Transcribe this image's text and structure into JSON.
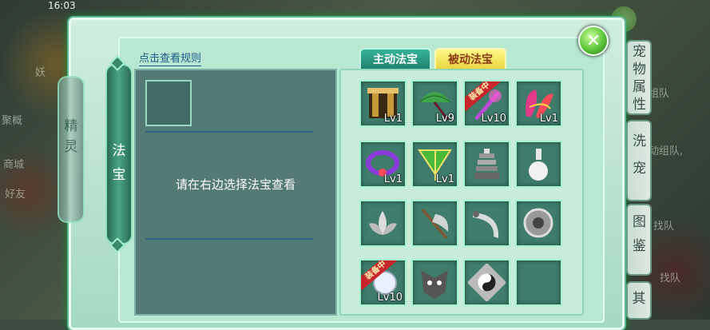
{
  "status_time": "16:03",
  "background_hints": [
    "妖",
    "聚概",
    "商城",
    "好友",
    "宠物属性",
    "组队",
    "动组队,",
    "找队",
    "找队"
  ],
  "rules_link": "点击查看规则",
  "hint_text": "请在右边选择法宝查看",
  "tabs": {
    "active": "主动法宝",
    "inactive": "被动法宝"
  },
  "left_tabs": [
    {
      "label": "精灵",
      "active": false
    },
    {
      "label": "法宝",
      "active": true
    }
  ],
  "right_tabs": [
    "宠物属性",
    "洗宠",
    "图鉴",
    "其"
  ],
  "close_label": "✕",
  "equipped_label": "装备中",
  "slots": [
    {
      "icon": "gate-icon",
      "level": "Lv1",
      "equipped": false
    },
    {
      "icon": "umbrella-icon",
      "level": "Lv9",
      "equipped": false
    },
    {
      "icon": "purple-sword-icon",
      "level": "Lv10",
      "equipped": true
    },
    {
      "icon": "red-flower-icon",
      "level": "Lv1",
      "equipped": false
    },
    {
      "icon": "purple-ring-icon",
      "level": "Lv1",
      "equipped": false
    },
    {
      "icon": "green-flag-icon",
      "level": "Lv1",
      "equipped": false
    },
    {
      "icon": "pagoda-icon",
      "level": "",
      "equipped": false
    },
    {
      "icon": "vase-icon",
      "level": "",
      "equipped": false
    },
    {
      "icon": "lotus-icon",
      "level": "",
      "equipped": false
    },
    {
      "icon": "axe-icon",
      "level": "",
      "equipped": false
    },
    {
      "icon": "hook-blade-icon",
      "level": "",
      "equipped": false
    },
    {
      "icon": "gear-wheel-icon",
      "level": "",
      "equipped": false
    },
    {
      "icon": "orb-icon",
      "level": "Lv10",
      "equipped": true
    },
    {
      "icon": "demon-mask-icon",
      "level": "",
      "equipped": false
    },
    {
      "icon": "yin-yang-icon",
      "level": "",
      "equipped": false
    },
    {
      "icon": "empty-slot",
      "level": "",
      "equipped": false
    }
  ]
}
